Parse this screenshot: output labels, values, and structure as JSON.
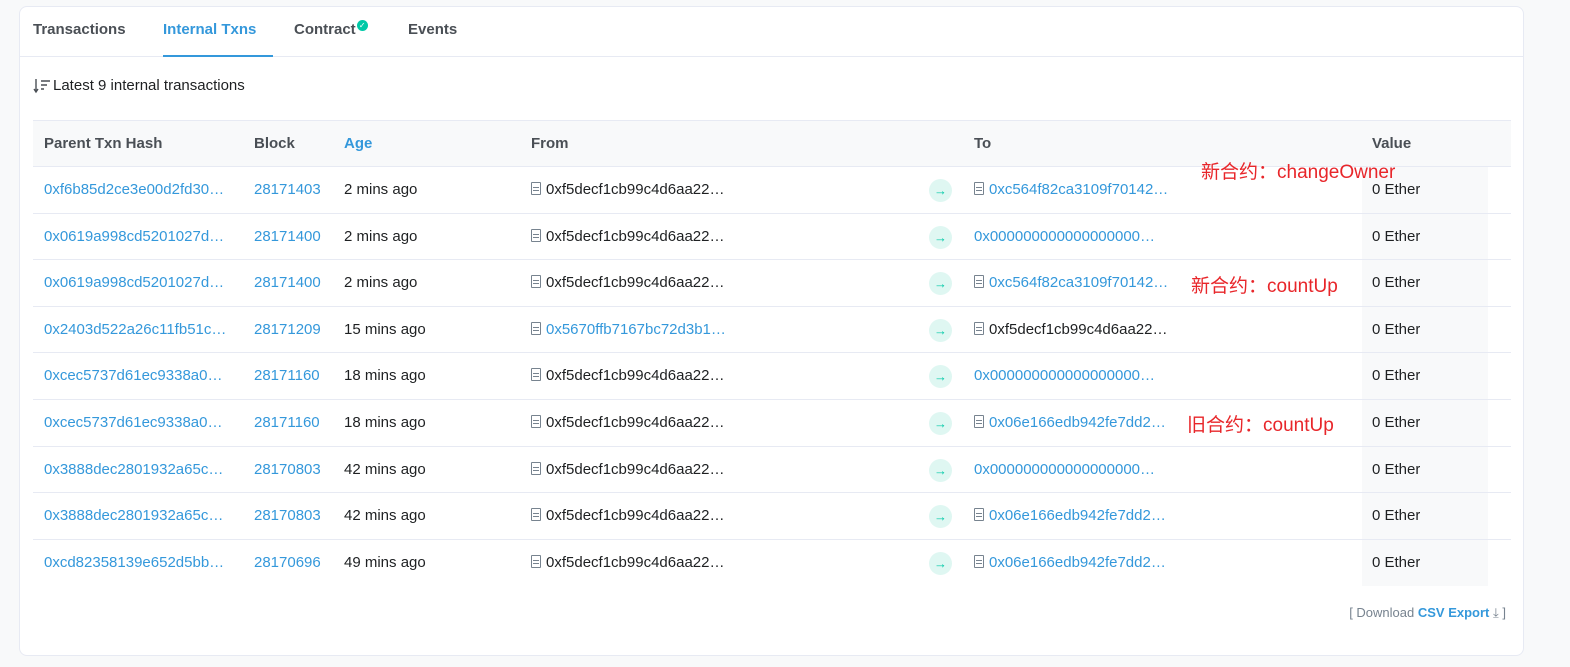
{
  "tabs": [
    {
      "label": "Transactions",
      "active": false
    },
    {
      "label": "Internal Txns",
      "active": true
    },
    {
      "label": "Contract",
      "active": false,
      "verified": true
    },
    {
      "label": "Events",
      "active": false
    }
  ],
  "summary": "Latest 9 internal transactions",
  "columns": {
    "parent": "Parent Txn Hash",
    "block": "Block",
    "age": "Age",
    "from": "From",
    "to": "To",
    "value": "Value"
  },
  "rows": [
    {
      "hash": "0xf6b85d2ce3e00d2fd30…",
      "block": "28171403",
      "age": "2 mins ago",
      "from": "0xf5decf1cb99c4d6aa22…",
      "from_link": false,
      "from_contract": true,
      "to": "0xc564f82ca3109f70142…",
      "to_link": true,
      "to_contract": true,
      "value": "0 Ether"
    },
    {
      "hash": "0x0619a998cd5201027d…",
      "block": "28171400",
      "age": "2 mins ago",
      "from": "0xf5decf1cb99c4d6aa22…",
      "from_link": false,
      "from_contract": true,
      "to": "0x000000000000000000…",
      "to_link": true,
      "to_contract": false,
      "value": "0 Ether"
    },
    {
      "hash": "0x0619a998cd5201027d…",
      "block": "28171400",
      "age": "2 mins ago",
      "from": "0xf5decf1cb99c4d6aa22…",
      "from_link": false,
      "from_contract": true,
      "to": "0xc564f82ca3109f70142…",
      "to_link": true,
      "to_contract": true,
      "value": "0 Ether"
    },
    {
      "hash": "0x2403d522a26c11fb51c…",
      "block": "28171209",
      "age": "15 mins ago",
      "from": "0x5670ffb7167bc72d3b1…",
      "from_link": true,
      "from_contract": true,
      "to": "0xf5decf1cb99c4d6aa22…",
      "to_link": false,
      "to_contract": true,
      "value": "0 Ether"
    },
    {
      "hash": "0xcec5737d61ec9338a0…",
      "block": "28171160",
      "age": "18 mins ago",
      "from": "0xf5decf1cb99c4d6aa22…",
      "from_link": false,
      "from_contract": true,
      "to": "0x000000000000000000…",
      "to_link": true,
      "to_contract": false,
      "value": "0 Ether"
    },
    {
      "hash": "0xcec5737d61ec9338a0…",
      "block": "28171160",
      "age": "18 mins ago",
      "from": "0xf5decf1cb99c4d6aa22…",
      "from_link": false,
      "from_contract": true,
      "to": "0x06e166edb942fe7dd2…",
      "to_link": true,
      "to_contract": true,
      "value": "0 Ether"
    },
    {
      "hash": "0x3888dec2801932a65c…",
      "block": "28170803",
      "age": "42 mins ago",
      "from": "0xf5decf1cb99c4d6aa22…",
      "from_link": false,
      "from_contract": true,
      "to": "0x000000000000000000…",
      "to_link": true,
      "to_contract": false,
      "value": "0 Ether"
    },
    {
      "hash": "0x3888dec2801932a65c…",
      "block": "28170803",
      "age": "42 mins ago",
      "from": "0xf5decf1cb99c4d6aa22…",
      "from_link": false,
      "from_contract": true,
      "to": "0x06e166edb942fe7dd2…",
      "to_link": true,
      "to_contract": true,
      "value": "0 Ether"
    },
    {
      "hash": "0xcd82358139e652d5bb…",
      "block": "28170696",
      "age": "49 mins ago",
      "from": "0xf5decf1cb99c4d6aa22…",
      "from_link": false,
      "from_contract": true,
      "to": "0x06e166edb942fe7dd2…",
      "to_link": true,
      "to_contract": true,
      "value": "0 Ether"
    }
  ],
  "annotations": [
    {
      "text": "新合约：changeOwner"
    },
    {
      "text": "新合约：countUp"
    },
    {
      "text": "旧合约：countUp"
    }
  ],
  "footer": {
    "prefix": "[ Download",
    "export_label": "CSV Export",
    "suffix": "]"
  },
  "colors": {
    "link": "#3498db",
    "annotation": "#e8262a",
    "arrow": "#00c9a7"
  }
}
